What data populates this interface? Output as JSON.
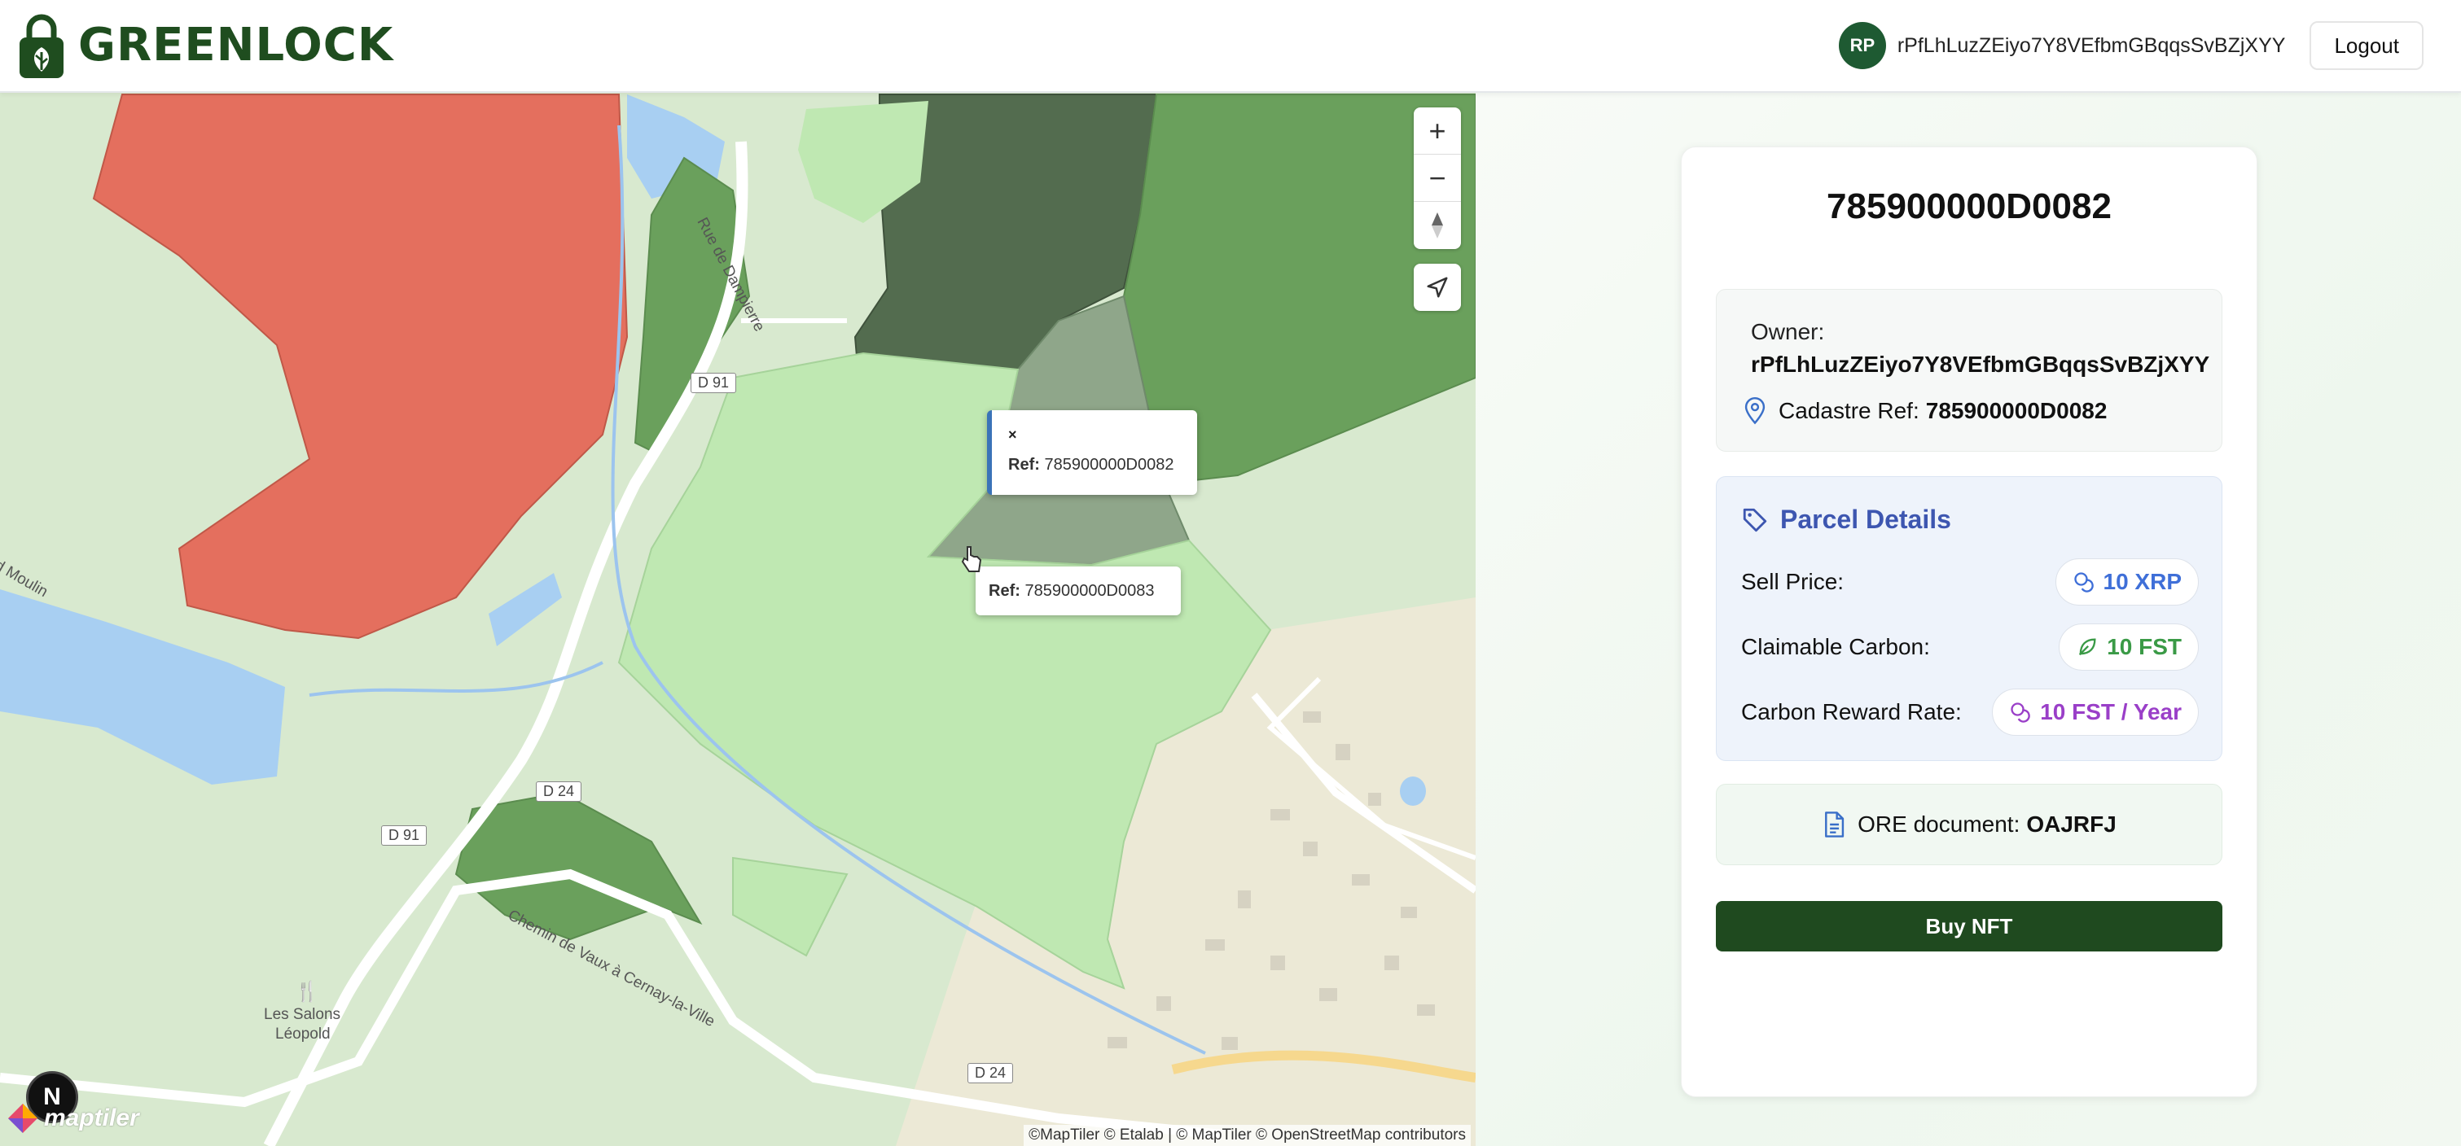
{
  "header": {
    "brand": "GREENLOCK",
    "avatar_initials": "RP",
    "user_address": "rPfLhLuzZEiyo7Y8VEfbmGBqqsSvBZjXYY",
    "logout_label": "Logout"
  },
  "map": {
    "zoom_in": "+",
    "zoom_out": "−",
    "popups": [
      {
        "ref_label": "Ref:",
        "ref_value": "785900000D0082",
        "close": "×"
      },
      {
        "ref_label": "Ref:",
        "ref_value": "785900000D0083"
      }
    ],
    "road_labels": {
      "d91_top": "D 91",
      "d91_bottom": "D 91",
      "d24_top": "D 24",
      "d24_bottom": "D 24"
    },
    "street_labels": {
      "rue_dampierre": "Rue de Dampierre",
      "moulin": "d Moulin",
      "chemin": "Chemin de Vaux à Cernay-la-Ville",
      "salons_1": "Les Salons",
      "salons_2": "Léopold"
    },
    "next_badge": "N",
    "maptiler_logo": "maptiler",
    "attribution": "©MapTiler © Etalab | © MapTiler © OpenStreetMap contributors"
  },
  "parcel": {
    "title": "785900000D0082",
    "owner_label": "Owner:",
    "owner_value": "rPfLhLuzZEiyo7Y8VEfbmGBqqsSvBZjXYY",
    "cadastre_label": "Cadastre Ref:",
    "cadastre_value": "785900000D0082",
    "details_title": "Parcel Details",
    "rows": [
      {
        "label": "Sell Price:",
        "value": "10 XRP",
        "icon": "coins-icon",
        "color": "#3f6fd8"
      },
      {
        "label": "Claimable Carbon:",
        "value": "10 FST",
        "icon": "leaf-icon",
        "color": "#3a9a46"
      },
      {
        "label": "Carbon Reward Rate:",
        "value": "10 FST / Year",
        "icon": "coins-icon",
        "color": "#9a3fc8"
      }
    ],
    "ore_label": "ORE document:",
    "ore_value": "OAJRFJ",
    "buy_label": "Buy NFT"
  },
  "colors": {
    "brand": "#1f4d1f",
    "button": "#1f4a1f",
    "parcel_red": "#e46f5e",
    "parcel_dark": "#536c4f",
    "parcel_selected": "#8fa68a",
    "parcel_light": "#bfe8b2",
    "parcel_mid": "#6aa05c"
  }
}
